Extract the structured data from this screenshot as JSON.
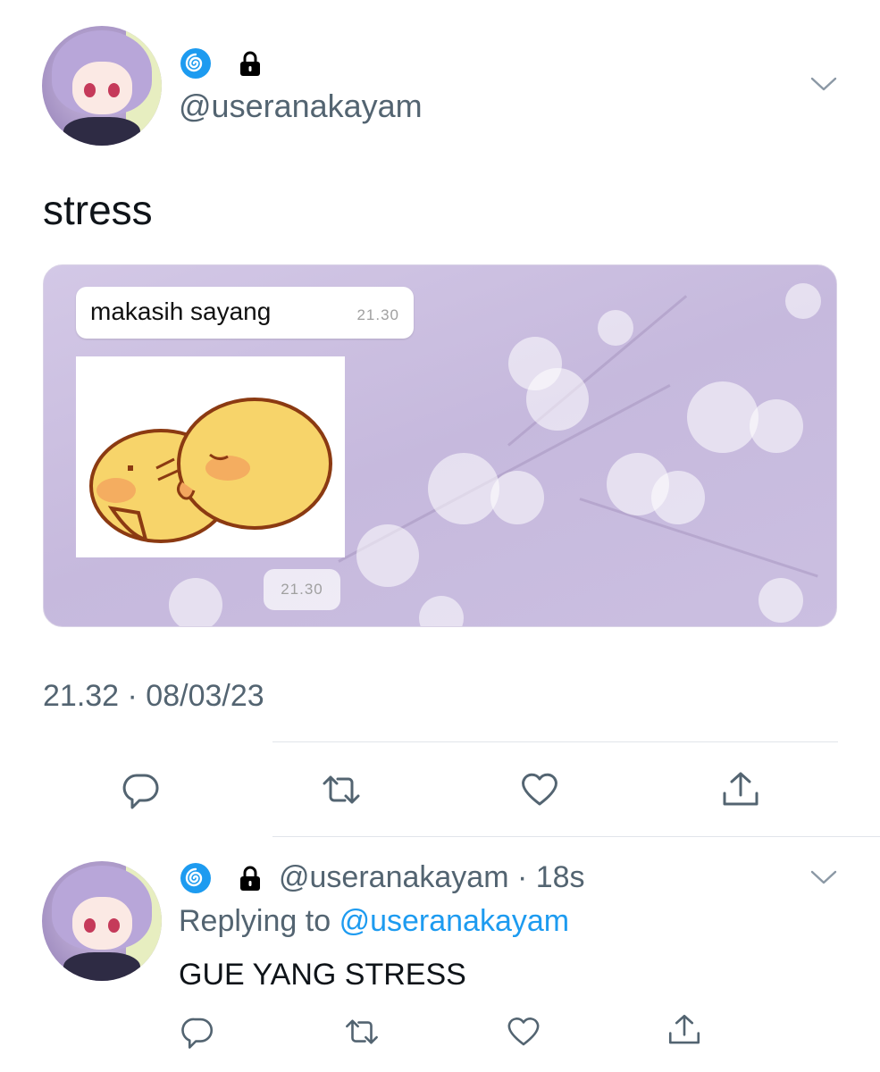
{
  "tweet": {
    "handle": "@useranakayam",
    "text": "stress",
    "timestamp": "21.32 · 08/03/23",
    "media": {
      "bubble_text": "makasih sayang",
      "bubble_time": "21.30",
      "sticker_time": "21.30"
    }
  },
  "reply": {
    "handle_line": "@useranakayam · 18s",
    "replying_prefix": "Replying to",
    "replying_mention": "@useranakayam",
    "text": "GUE YANG STRESS"
  },
  "icons": {
    "badge": "swirl-emoji-icon",
    "lock": "lock-icon",
    "more": "chevron-down-icon",
    "reply": "reply-icon",
    "retweet": "retweet-icon",
    "like": "heart-icon",
    "share": "share-icon"
  },
  "colors": {
    "accent": "#1d9bf0",
    "secondary_text": "#536471",
    "primary_text": "#0f1419"
  }
}
